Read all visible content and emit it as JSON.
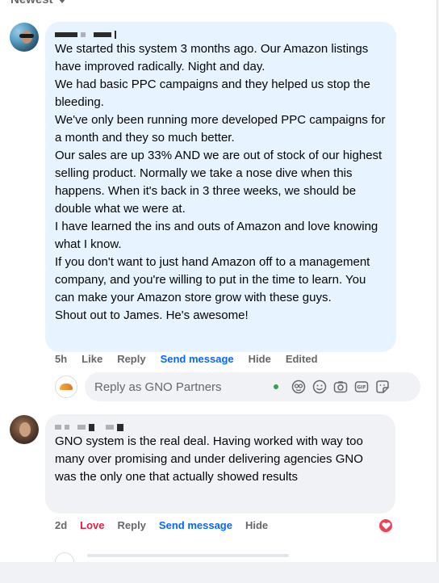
{
  "sort": {
    "label": "Newest"
  },
  "comments": [
    {
      "text": "We started this system 3 months ago. Our Amazon listings have improved radically. Night and day.\nWe had basic PPC campaigns and they helped us stop the bleeding.\nWe've only been running more developed PPC campaigns for a month and they so much better.\nOur sales are up 33% AND we are out of stock of our highest selling product. Normally we take a nose dive when this happens. When it's back in 3 three weeks, we should be double what we were at.\nI have learned the ins and outs of Amazon and love knowing what I know.\nIf you don't want to just hand Amazon off to a management company, and you're willing to put in the time to learn. You can make your Amazon store grow with these guys.\nShout out to James. He's awesome!",
      "time": "5h",
      "actions": {
        "like": "Like",
        "reply": "Reply",
        "send": "Send message",
        "hide": "Hide",
        "edited": "Edited"
      }
    },
    {
      "text": "GNO system is the real deal. Having worked with way too many over promising and under delivering agencies GNO was the only one that actually showed results",
      "time": "2d",
      "actions": {
        "love": "Love",
        "reply": "Reply",
        "send": "Send message",
        "hide": "Hide"
      }
    }
  ],
  "reply": {
    "placeholder": "Reply as GNO Partners"
  },
  "colors": {
    "accent": "#0866ff",
    "love": "#e41e3f",
    "bubble_highlight": "#e7f3ff",
    "bubble": "#f0f2f5",
    "online": "#31a24c"
  }
}
